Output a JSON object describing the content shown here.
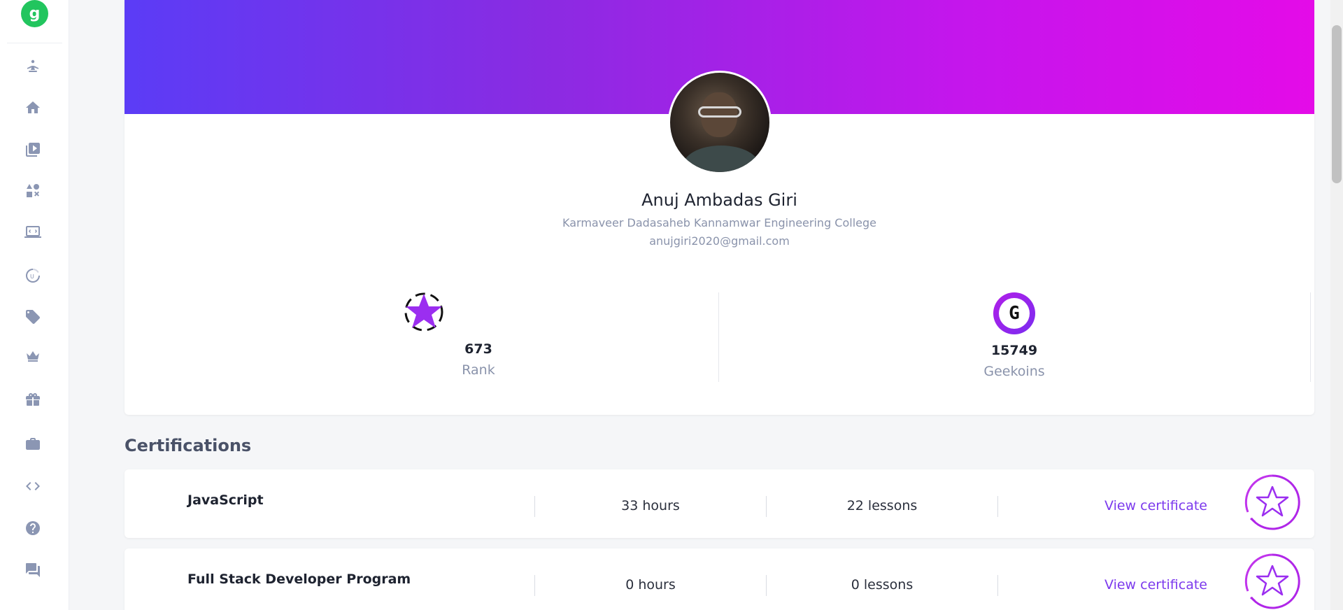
{
  "sidebar": {
    "logo_text": "g",
    "items": [
      {
        "name": "problem-of-day",
        "icon": "meditation-icon"
      },
      {
        "name": "home",
        "icon": "home-icon"
      },
      {
        "name": "courses",
        "icon": "video-library-icon"
      },
      {
        "name": "practice",
        "icon": "shapes-icon"
      },
      {
        "name": "jobs-laptop",
        "icon": "laptop-icon"
      },
      {
        "name": "progress",
        "icon": "progress-icon"
      },
      {
        "name": "tags",
        "icon": "tag-icon"
      },
      {
        "name": "premium",
        "icon": "crown-icon"
      },
      {
        "name": "gifts",
        "icon": "gift-icon"
      },
      {
        "name": "jobs",
        "icon": "briefcase-icon"
      },
      {
        "name": "ide",
        "icon": "code-icon"
      },
      {
        "name": "help",
        "icon": "help-icon"
      },
      {
        "name": "feedback",
        "icon": "chat-icon"
      }
    ]
  },
  "profile": {
    "name": "Anuj Ambadas Giri",
    "college": "Karmaveer Dadasaheb Kannamwar Engineering College",
    "email": "anujgiri2020@gmail.com",
    "rank_value": "673",
    "rank_label": "Rank",
    "geekoins_value": "15749",
    "geekoins_label": "Geekoins",
    "geekoin_icon_text": "G"
  },
  "certifications": {
    "title": "Certifications",
    "items": [
      {
        "name": "JavaScript",
        "hours": "33 hours",
        "lessons": "22 lessons",
        "link": "View certificate"
      },
      {
        "name": "Full Stack Developer Program",
        "hours": "0 hours",
        "lessons": "0 lessons",
        "link": "View certificate"
      }
    ]
  },
  "colors": {
    "accent": "#7c3aed",
    "banner_start": "#5b3cf6",
    "banner_end": "#e40be8",
    "logo": "#22c55e"
  }
}
